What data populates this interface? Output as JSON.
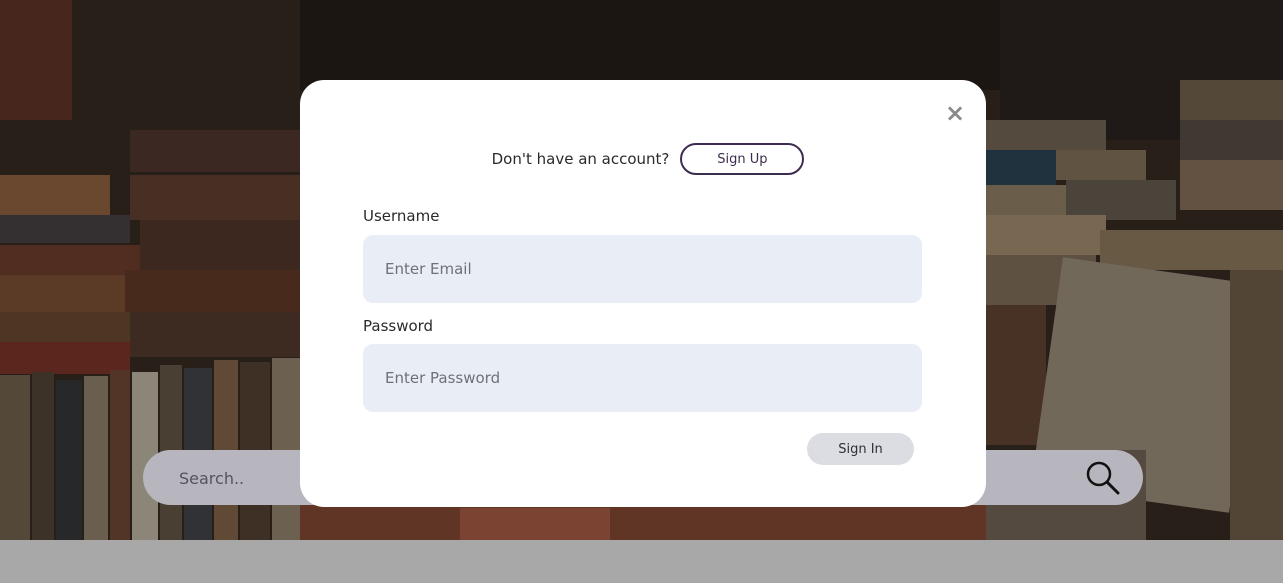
{
  "search": {
    "placeholder": "Search.."
  },
  "modal": {
    "close_symbol": "×",
    "signup_prompt": "Don't have an account?",
    "signup_label": "Sign Up",
    "username_label": "Username",
    "username_placeholder": "Enter Email",
    "password_label": "Password",
    "password_placeholder": "Enter Password",
    "signin_label": "Sign In"
  },
  "colors": {
    "accent": "#3e2c50",
    "input_bg": "#e9edf6",
    "signin_bg": "#dcdde3",
    "search_bg": "#b7b5bd"
  },
  "icons": {
    "search": "search-icon",
    "close": "close-icon"
  }
}
